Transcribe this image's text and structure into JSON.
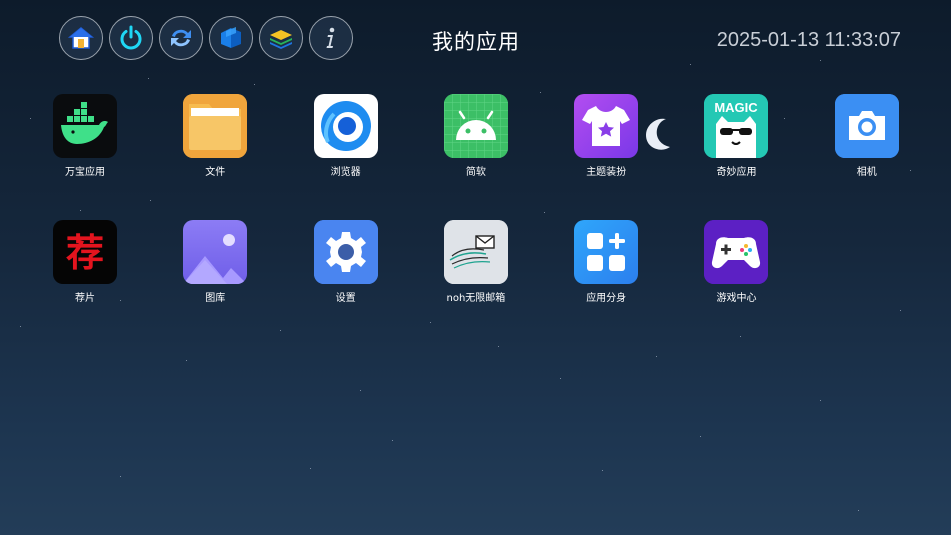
{
  "header": {
    "title": "我的应用",
    "datetime": "2025-01-13 11:33:07"
  },
  "toolbar": {
    "buttons": [
      {
        "icon": "home-icon"
      },
      {
        "icon": "power-icon"
      },
      {
        "icon": "refresh-icon"
      },
      {
        "icon": "cube-icon"
      },
      {
        "icon": "layers-icon"
      },
      {
        "icon": "info-icon"
      }
    ]
  },
  "apps": [
    {
      "label": "万宝应用",
      "icon": "docker-whale-icon"
    },
    {
      "label": "文件",
      "icon": "folder-icon"
    },
    {
      "label": "浏览器",
      "icon": "browser-icon"
    },
    {
      "label": "简软",
      "icon": "android-icon"
    },
    {
      "label": "主题装扮",
      "icon": "tshirt-icon"
    },
    {
      "label": "奇妙应用",
      "icon": "magic-cat-icon",
      "badge": "MAGIC"
    },
    {
      "label": "相机",
      "icon": "camera-icon"
    },
    {
      "label": "荐片",
      "icon": "jianpian-icon",
      "glyph": "荐"
    },
    {
      "label": "图库",
      "icon": "gallery-icon"
    },
    {
      "label": "设置",
      "icon": "settings-gear-icon"
    },
    {
      "label": "noh无限邮箱",
      "icon": "mail-icon"
    },
    {
      "label": "应用分身",
      "icon": "app-clone-icon"
    },
    {
      "label": "游戏中心",
      "icon": "gamepad-icon"
    }
  ],
  "colors": {
    "background": "#15273c",
    "text": "#ffffff",
    "clock_text": "#c8ced6"
  }
}
